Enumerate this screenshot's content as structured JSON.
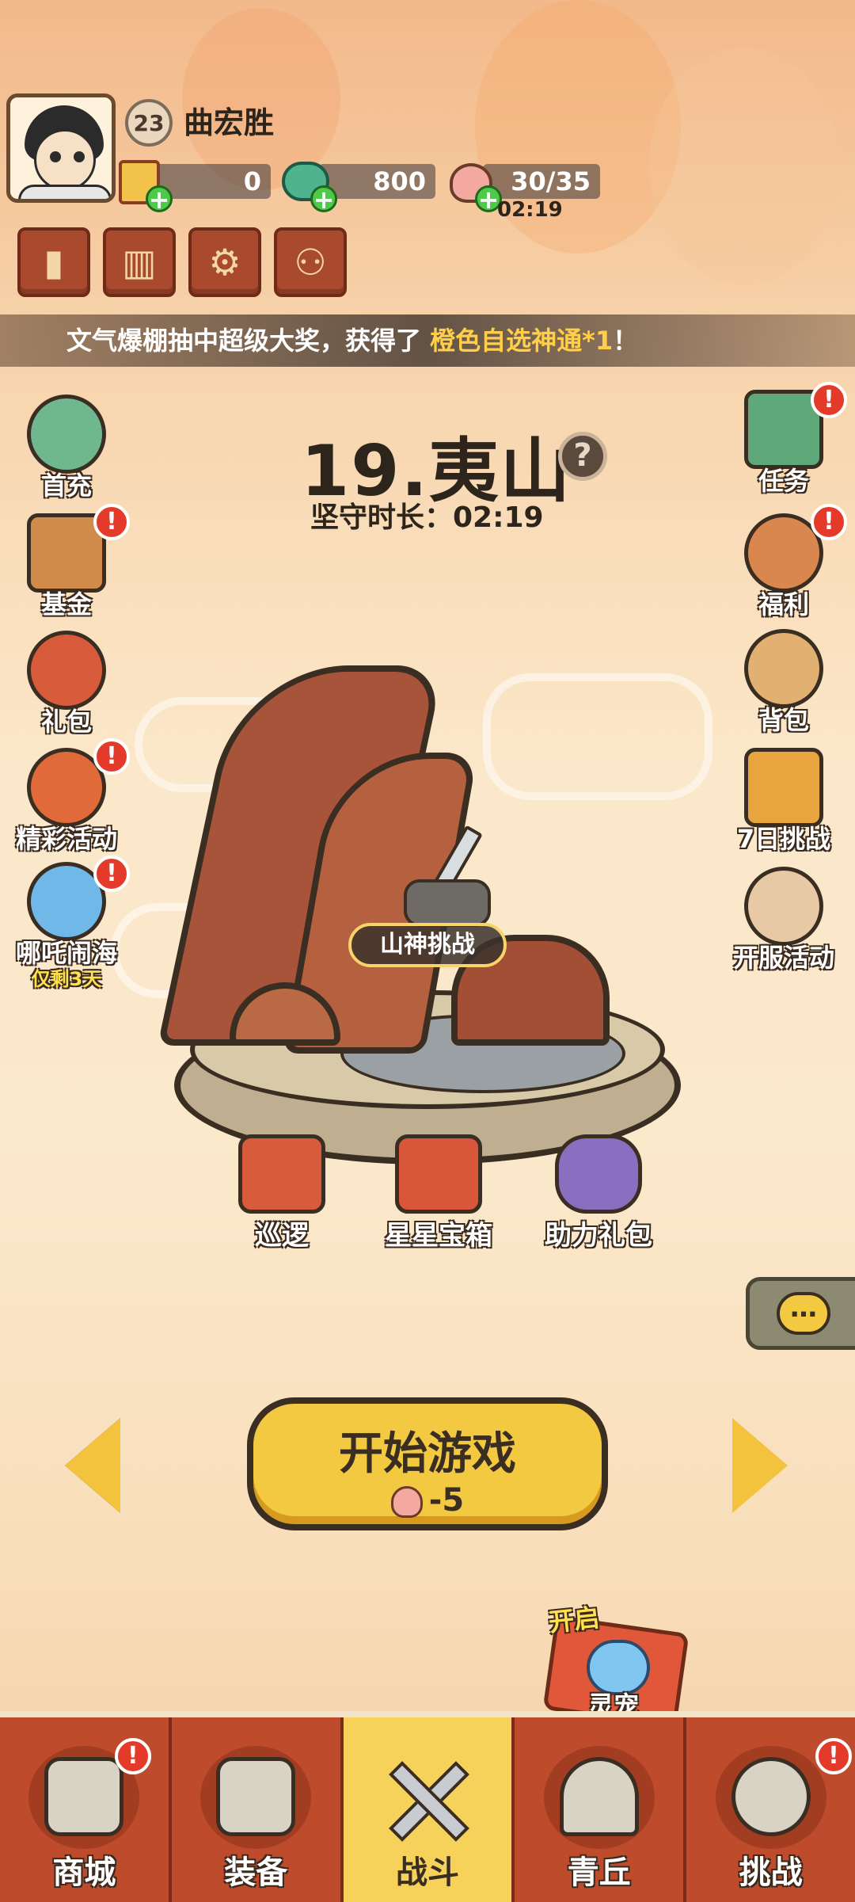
{
  "player": {
    "level": "23",
    "name": "曲宏胜"
  },
  "resources": {
    "gold": "0",
    "jade": "800",
    "stamina": "30/35",
    "stamina_timer": "02:19"
  },
  "marquee": {
    "prefix": "文气爆棚抽中超级大奖，获得了 ",
    "highlight": "橙色自选神通*1",
    "suffix": "！"
  },
  "stage": {
    "title": "19.夷山",
    "guard_time": "坚守时长：02:19",
    "challenge_label": "山神挑战"
  },
  "left_menu": [
    {
      "label": "首充"
    },
    {
      "label": "基金"
    },
    {
      "label": "礼包"
    },
    {
      "label": "精彩活动"
    },
    {
      "label": "哪吒闹海",
      "sub": "仅剩3天"
    }
  ],
  "right_menu": [
    {
      "label": "任务"
    },
    {
      "label": "福利"
    },
    {
      "label": "背包"
    },
    {
      "label": "7日挑战"
    },
    {
      "label": "开服活动"
    }
  ],
  "stage_items": [
    {
      "label": "巡逻"
    },
    {
      "label": "星星宝箱"
    },
    {
      "label": "助力礼包"
    }
  ],
  "start_button": {
    "label": "开始游戏",
    "cost": "-5"
  },
  "pet_unlock": {
    "open_label": "开启",
    "name": "灵宠"
  },
  "bottom_nav": [
    {
      "label": "商城"
    },
    {
      "label": "装备"
    },
    {
      "label": "战斗"
    },
    {
      "label": "青丘"
    },
    {
      "label": "挑战"
    }
  ],
  "badge_text": "!",
  "colors": {
    "accent": "#f4c942",
    "nav_bg": "#bd4b2c",
    "badge": "#e33a2a"
  }
}
